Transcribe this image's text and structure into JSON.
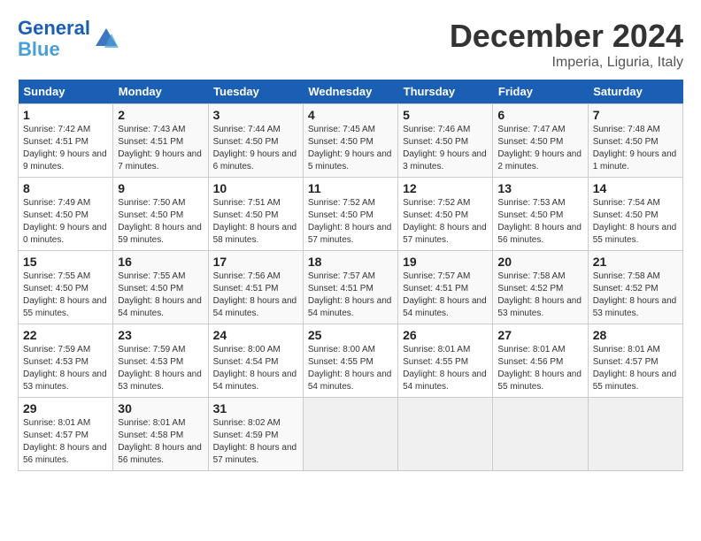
{
  "header": {
    "logo_line1": "General",
    "logo_line2": "Blue",
    "month": "December 2024",
    "location": "Imperia, Liguria, Italy"
  },
  "weekdays": [
    "Sunday",
    "Monday",
    "Tuesday",
    "Wednesday",
    "Thursday",
    "Friday",
    "Saturday"
  ],
  "weeks": [
    [
      {
        "day": "1",
        "info": "Sunrise: 7:42 AM\nSunset: 4:51 PM\nDaylight: 9 hours and 9 minutes."
      },
      {
        "day": "2",
        "info": "Sunrise: 7:43 AM\nSunset: 4:51 PM\nDaylight: 9 hours and 7 minutes."
      },
      {
        "day": "3",
        "info": "Sunrise: 7:44 AM\nSunset: 4:50 PM\nDaylight: 9 hours and 6 minutes."
      },
      {
        "day": "4",
        "info": "Sunrise: 7:45 AM\nSunset: 4:50 PM\nDaylight: 9 hours and 5 minutes."
      },
      {
        "day": "5",
        "info": "Sunrise: 7:46 AM\nSunset: 4:50 PM\nDaylight: 9 hours and 3 minutes."
      },
      {
        "day": "6",
        "info": "Sunrise: 7:47 AM\nSunset: 4:50 PM\nDaylight: 9 hours and 2 minutes."
      },
      {
        "day": "7",
        "info": "Sunrise: 7:48 AM\nSunset: 4:50 PM\nDaylight: 9 hours and 1 minute."
      }
    ],
    [
      {
        "day": "8",
        "info": "Sunrise: 7:49 AM\nSunset: 4:50 PM\nDaylight: 9 hours and 0 minutes."
      },
      {
        "day": "9",
        "info": "Sunrise: 7:50 AM\nSunset: 4:50 PM\nDaylight: 8 hours and 59 minutes."
      },
      {
        "day": "10",
        "info": "Sunrise: 7:51 AM\nSunset: 4:50 PM\nDaylight: 8 hours and 58 minutes."
      },
      {
        "day": "11",
        "info": "Sunrise: 7:52 AM\nSunset: 4:50 PM\nDaylight: 8 hours and 57 minutes."
      },
      {
        "day": "12",
        "info": "Sunrise: 7:52 AM\nSunset: 4:50 PM\nDaylight: 8 hours and 57 minutes."
      },
      {
        "day": "13",
        "info": "Sunrise: 7:53 AM\nSunset: 4:50 PM\nDaylight: 8 hours and 56 minutes."
      },
      {
        "day": "14",
        "info": "Sunrise: 7:54 AM\nSunset: 4:50 PM\nDaylight: 8 hours and 55 minutes."
      }
    ],
    [
      {
        "day": "15",
        "info": "Sunrise: 7:55 AM\nSunset: 4:50 PM\nDaylight: 8 hours and 55 minutes."
      },
      {
        "day": "16",
        "info": "Sunrise: 7:55 AM\nSunset: 4:50 PM\nDaylight: 8 hours and 54 minutes."
      },
      {
        "day": "17",
        "info": "Sunrise: 7:56 AM\nSunset: 4:51 PM\nDaylight: 8 hours and 54 minutes."
      },
      {
        "day": "18",
        "info": "Sunrise: 7:57 AM\nSunset: 4:51 PM\nDaylight: 8 hours and 54 minutes."
      },
      {
        "day": "19",
        "info": "Sunrise: 7:57 AM\nSunset: 4:51 PM\nDaylight: 8 hours and 54 minutes."
      },
      {
        "day": "20",
        "info": "Sunrise: 7:58 AM\nSunset: 4:52 PM\nDaylight: 8 hours and 53 minutes."
      },
      {
        "day": "21",
        "info": "Sunrise: 7:58 AM\nSunset: 4:52 PM\nDaylight: 8 hours and 53 minutes."
      }
    ],
    [
      {
        "day": "22",
        "info": "Sunrise: 7:59 AM\nSunset: 4:53 PM\nDaylight: 8 hours and 53 minutes."
      },
      {
        "day": "23",
        "info": "Sunrise: 7:59 AM\nSunset: 4:53 PM\nDaylight: 8 hours and 53 minutes."
      },
      {
        "day": "24",
        "info": "Sunrise: 8:00 AM\nSunset: 4:54 PM\nDaylight: 8 hours and 54 minutes."
      },
      {
        "day": "25",
        "info": "Sunrise: 8:00 AM\nSunset: 4:55 PM\nDaylight: 8 hours and 54 minutes."
      },
      {
        "day": "26",
        "info": "Sunrise: 8:01 AM\nSunset: 4:55 PM\nDaylight: 8 hours and 54 minutes."
      },
      {
        "day": "27",
        "info": "Sunrise: 8:01 AM\nSunset: 4:56 PM\nDaylight: 8 hours and 55 minutes."
      },
      {
        "day": "28",
        "info": "Sunrise: 8:01 AM\nSunset: 4:57 PM\nDaylight: 8 hours and 55 minutes."
      }
    ],
    [
      {
        "day": "29",
        "info": "Sunrise: 8:01 AM\nSunset: 4:57 PM\nDaylight: 8 hours and 56 minutes."
      },
      {
        "day": "30",
        "info": "Sunrise: 8:01 AM\nSunset: 4:58 PM\nDaylight: 8 hours and 56 minutes."
      },
      {
        "day": "31",
        "info": "Sunrise: 8:02 AM\nSunset: 4:59 PM\nDaylight: 8 hours and 57 minutes."
      },
      null,
      null,
      null,
      null
    ]
  ]
}
